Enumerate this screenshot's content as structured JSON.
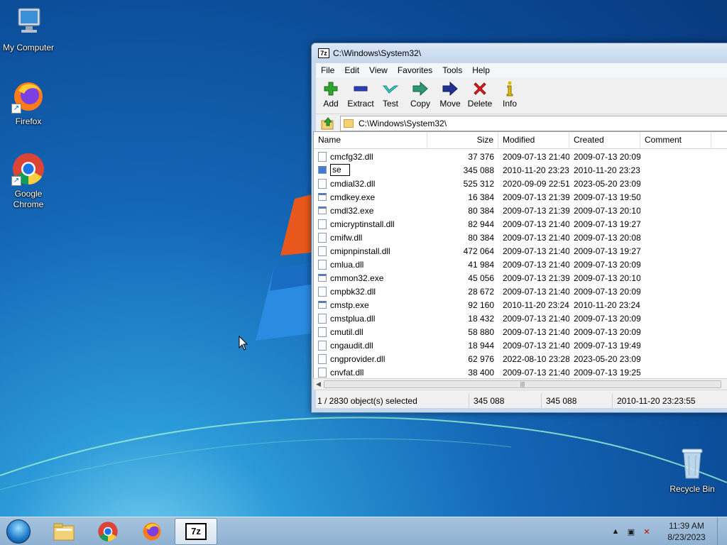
{
  "desktop": {
    "icons": [
      {
        "label": "My Computer"
      },
      {
        "label": "Firefox"
      },
      {
        "label": "Google Chrome"
      },
      {
        "label": "Recycle Bin"
      }
    ]
  },
  "window": {
    "title": "C:\\Windows\\System32\\",
    "menu": [
      "File",
      "Edit",
      "View",
      "Favorites",
      "Tools",
      "Help"
    ],
    "toolbar": [
      "Add",
      "Extract",
      "Test",
      "Copy",
      "Move",
      "Delete",
      "Info"
    ],
    "address": "C:\\Windows\\System32\\",
    "columns": [
      "Name",
      "Size",
      "Modified",
      "Created",
      "Comment"
    ],
    "files": [
      {
        "name": "cmcfg32.dll",
        "size": "37 376",
        "modified": "2009-07-13 21:40",
        "created": "2009-07-13 20:09",
        "type": "dll"
      },
      {
        "name": "se",
        "size": "345 088",
        "modified": "2010-11-20 23:23",
        "created": "2010-11-20 23:23",
        "type": "exe",
        "renaming": true
      },
      {
        "name": "cmdial32.dll",
        "size": "525 312",
        "modified": "2020-09-09 22:51",
        "created": "2023-05-20 23:09",
        "type": "dll"
      },
      {
        "name": "cmdkey.exe",
        "size": "16 384",
        "modified": "2009-07-13 21:39",
        "created": "2009-07-13 19:50",
        "type": "exe"
      },
      {
        "name": "cmdl32.exe",
        "size": "80 384",
        "modified": "2009-07-13 21:39",
        "created": "2009-07-13 20:10",
        "type": "exe"
      },
      {
        "name": "cmicryptinstall.dll",
        "size": "82 944",
        "modified": "2009-07-13 21:40",
        "created": "2009-07-13 19:27",
        "type": "dll"
      },
      {
        "name": "cmifw.dll",
        "size": "80 384",
        "modified": "2009-07-13 21:40",
        "created": "2009-07-13 20:08",
        "type": "dll"
      },
      {
        "name": "cmipnpinstall.dll",
        "size": "472 064",
        "modified": "2009-07-13 21:40",
        "created": "2009-07-13 19:27",
        "type": "dll"
      },
      {
        "name": "cmlua.dll",
        "size": "41 984",
        "modified": "2009-07-13 21:40",
        "created": "2009-07-13 20:09",
        "type": "dll"
      },
      {
        "name": "cmmon32.exe",
        "size": "45 056",
        "modified": "2009-07-13 21:39",
        "created": "2009-07-13 20:10",
        "type": "exe"
      },
      {
        "name": "cmpbk32.dll",
        "size": "28 672",
        "modified": "2009-07-13 21:40",
        "created": "2009-07-13 20:09",
        "type": "dll"
      },
      {
        "name": "cmstp.exe",
        "size": "92 160",
        "modified": "2010-11-20 23:24",
        "created": "2010-11-20 23:24",
        "type": "exe"
      },
      {
        "name": "cmstplua.dll",
        "size": "18 432",
        "modified": "2009-07-13 21:40",
        "created": "2009-07-13 20:09",
        "type": "dll"
      },
      {
        "name": "cmutil.dll",
        "size": "58 880",
        "modified": "2009-07-13 21:40",
        "created": "2009-07-13 20:09",
        "type": "dll"
      },
      {
        "name": "cngaudit.dll",
        "size": "18 944",
        "modified": "2009-07-13 21:40",
        "created": "2009-07-13 19:49",
        "type": "dll"
      },
      {
        "name": "cngprovider.dll",
        "size": "62 976",
        "modified": "2022-08-10 23:28",
        "created": "2023-05-20 23:09",
        "type": "dll"
      },
      {
        "name": "cnvfat.dll",
        "size": "38 400",
        "modified": "2009-07-13 21:40",
        "created": "2009-07-13 19:25",
        "type": "dll"
      }
    ],
    "status": {
      "selection": "1 / 2830 object(s) selected",
      "size": "345 088",
      "packed": "345 088",
      "date": "2010-11-20 23:23:55"
    }
  },
  "taskbar": {
    "apps": [
      "explorer-icon",
      "chrome-icon",
      "firefox-icon",
      "7zip-icon"
    ],
    "clock": {
      "time": "11:39 AM",
      "date": "8/23/2023"
    }
  }
}
